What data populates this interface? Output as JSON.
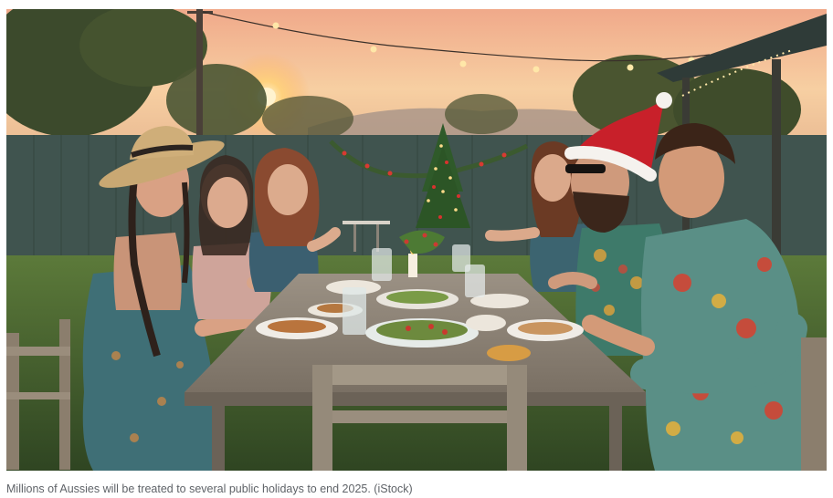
{
  "image": {
    "caption": "Millions of Aussies will be treated to several public holidays to end 2025. (iStock)",
    "colors": {
      "sky_top": "#f3b796",
      "sky_glow": "#f9d7a6",
      "fence": "#3f5550",
      "grass": "#4d6a33",
      "table": "#8e857a",
      "santa_hat": "#c8202a"
    }
  }
}
